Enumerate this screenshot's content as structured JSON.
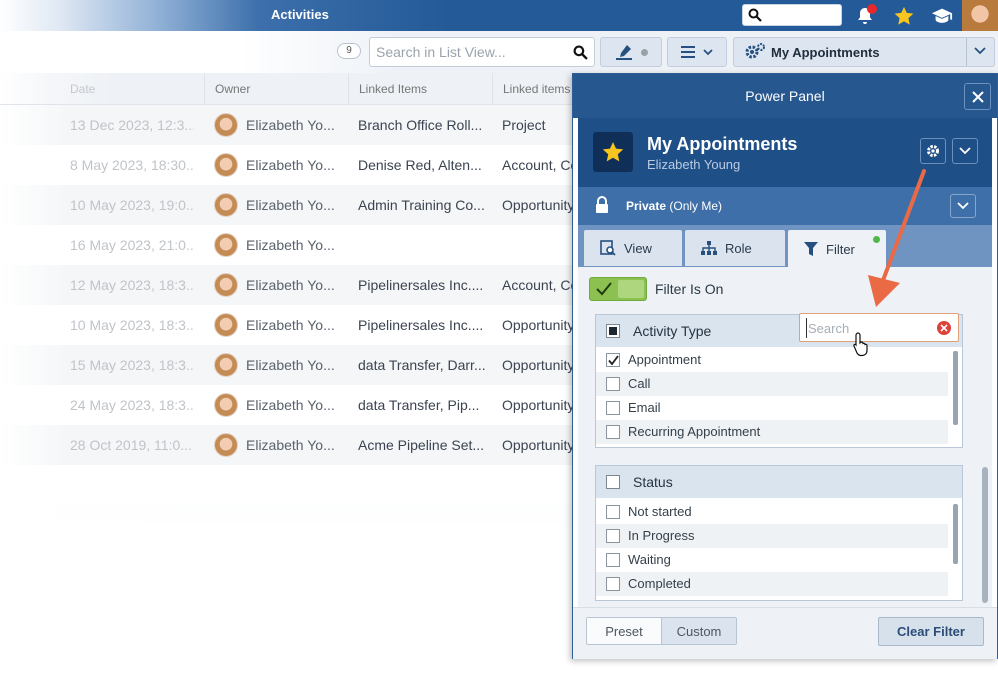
{
  "topbar": {
    "title": "Activities"
  },
  "toolbar": {
    "count": "9",
    "search_placeholder": "Search in List View...",
    "view_name": "My Appointments"
  },
  "table": {
    "columns": [
      "Date",
      "Owner",
      "Linked Items",
      "Linked items"
    ],
    "rows": [
      {
        "date": "13 Dec 2023, 12:3...",
        "owner": "Elizabeth Yo...",
        "linked": "Branch Office Roll...",
        "type": "Project"
      },
      {
        "date": "8 May 2023, 18:30...",
        "owner": "Elizabeth Yo...",
        "linked": "Denise Red, Alten...",
        "type": "Account, Co"
      },
      {
        "date": "10 May 2023, 19:0...",
        "owner": "Elizabeth Yo...",
        "linked": "Admin Training Co...",
        "type": "Opportunity"
      },
      {
        "date": "16 May 2023, 21:0...",
        "owner": "Elizabeth Yo...",
        "linked": "",
        "type": ""
      },
      {
        "date": "12 May 2023, 18:3...",
        "owner": "Elizabeth Yo...",
        "linked": "Pipelinersales Inc....",
        "type": "Account, Co"
      },
      {
        "date": "10 May 2023, 18:3...",
        "owner": "Elizabeth Yo...",
        "linked": "Pipelinersales Inc....",
        "type": "Opportunity"
      },
      {
        "date": "15 May 2023, 18:3...",
        "owner": "Elizabeth Yo...",
        "linked": "data Transfer, Darr...",
        "type": "Opportunity"
      },
      {
        "date": "24 May 2023, 18:3...",
        "owner": "Elizabeth Yo...",
        "linked": "data Transfer, Pip...",
        "type": "Opportunity"
      },
      {
        "date": "28 Oct 2019, 11:0...",
        "owner": "Elizabeth Yo...",
        "linked": "Acme Pipeline Set...",
        "type": "Opportunity"
      }
    ]
  },
  "panel": {
    "title": "Power Panel",
    "view_name": "My Appointments",
    "view_owner": "Elizabeth Young",
    "privacy_strong": "Private",
    "privacy_note": " (Only Me)",
    "tabs": [
      "View",
      "Role",
      "Filter"
    ],
    "filter_toggle_label": "Filter Is On",
    "search_placeholder": "Search",
    "groups": [
      {
        "title": "Activity Type",
        "options": [
          {
            "label": "Appointment",
            "checked": true
          },
          {
            "label": "Call",
            "checked": false
          },
          {
            "label": "Email",
            "checked": false
          },
          {
            "label": "Recurring Appointment",
            "checked": false
          }
        ]
      },
      {
        "title": "Status",
        "options": [
          {
            "label": "Not started",
            "checked": false
          },
          {
            "label": "In Progress",
            "checked": false
          },
          {
            "label": "Waiting",
            "checked": false
          },
          {
            "label": "Completed",
            "checked": false
          }
        ]
      }
    ],
    "footer": {
      "preset": "Preset",
      "custom": "Custom",
      "clear": "Clear Filter"
    }
  },
  "colors": {
    "header_blue": "#27578f",
    "accent_orange": "#e8623a",
    "filter_green": "#8cc152"
  }
}
